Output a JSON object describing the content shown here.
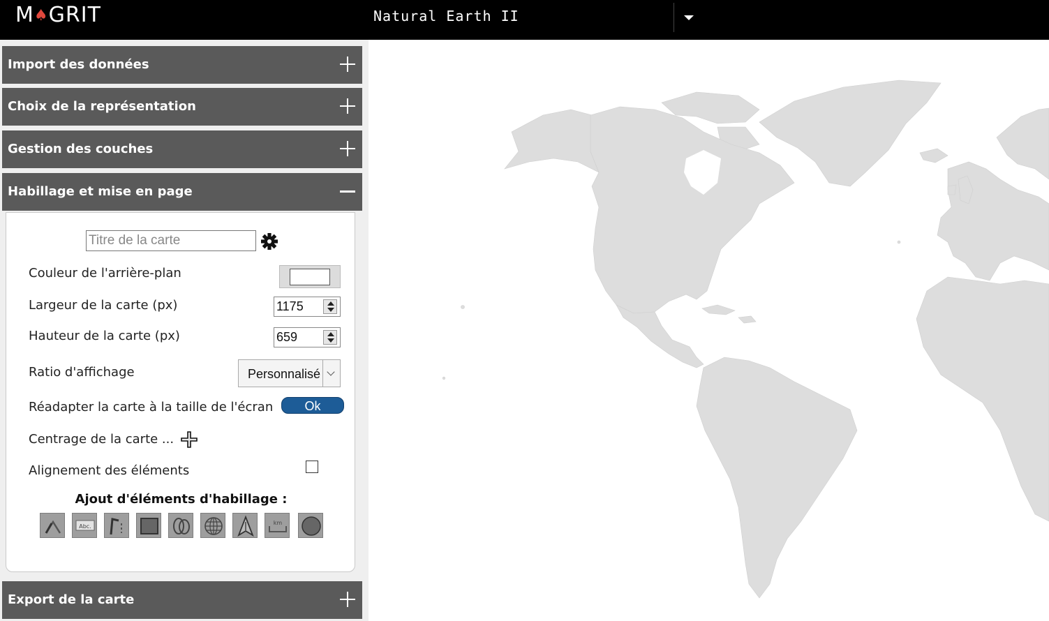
{
  "app": {
    "logo_text_left": "M",
    "logo_text_right": "GRIT",
    "project_name": "Natural Earth II"
  },
  "sections": {
    "import": {
      "title": "Import des données",
      "state": "collapsed"
    },
    "representation": {
      "title": "Choix de la représentation",
      "state": "collapsed"
    },
    "layers": {
      "title": "Gestion des couches",
      "state": "collapsed"
    },
    "layout": {
      "title": "Habillage et mise en page",
      "state": "expanded"
    },
    "export": {
      "title": "Export de la carte",
      "state": "collapsed"
    }
  },
  "layout_panel": {
    "title_placeholder": "Titre de la carte",
    "title_value": "",
    "bg_color_label": "Couleur de l'arrière-plan",
    "bg_color": "#ffffff",
    "width_label": "Largeur de la carte (px)",
    "width_value": "1175",
    "height_label": "Hauteur de la carte (px)",
    "height_value": "659",
    "ratio_label": "Ratio d'affichage",
    "ratio_value": "Personnalisé",
    "fit_label": "Réadapter la carte à la taille de l'écran",
    "fit_button": "Ok",
    "center_label": "Centrage de la carte ...",
    "align_label": "Alignement des éléments",
    "align_checked": false,
    "elements_heading": "Ajout d'éléments d'habillage :",
    "tools": [
      {
        "icon": "arrow-tool-icon"
      },
      {
        "icon": "text-annotation-icon",
        "text": "Abc."
      },
      {
        "icon": "ruler-tool-icon"
      },
      {
        "icon": "rectangle-tool-icon"
      },
      {
        "icon": "ellipse-tool-icon"
      },
      {
        "icon": "graticule-icon"
      },
      {
        "icon": "north-arrow-icon"
      },
      {
        "icon": "scale-bar-icon",
        "text": "km"
      },
      {
        "icon": "sphere-icon"
      }
    ]
  },
  "colors": {
    "header_bg": "#5a5a5a",
    "topbar_bg": "#000000",
    "accent": "#1d5c97",
    "land": "#dddddd"
  }
}
